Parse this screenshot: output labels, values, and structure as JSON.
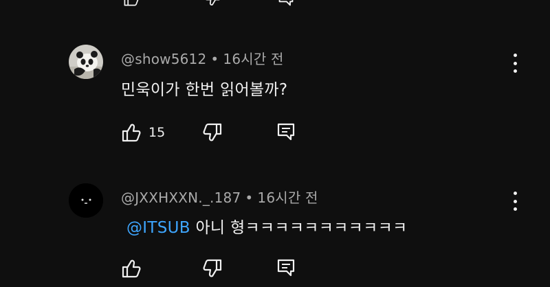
{
  "comments": [
    {
      "username": "@show5612",
      "separator": "•",
      "time": "16시간 전",
      "text": "민욱이가 한번 읽어볼까?",
      "like_count": "15"
    },
    {
      "username": "@JXXHXXN._.187",
      "separator": "•",
      "time": "16시간 전",
      "mention": "@ITSUB",
      "text": " 아니 형ㅋㅋㅋㅋㅋㅋㅋㅋㅋㅋㅋ",
      "like_count": ""
    }
  ],
  "colors": {
    "background": "#0f0f0f",
    "text": "#f1f1f1",
    "meta": "#aaaaaa",
    "mention": "#3ea6ff"
  },
  "icons": [
    "thumbs-up-icon",
    "thumbs-down-icon",
    "reply-icon",
    "more-vert-icon"
  ]
}
